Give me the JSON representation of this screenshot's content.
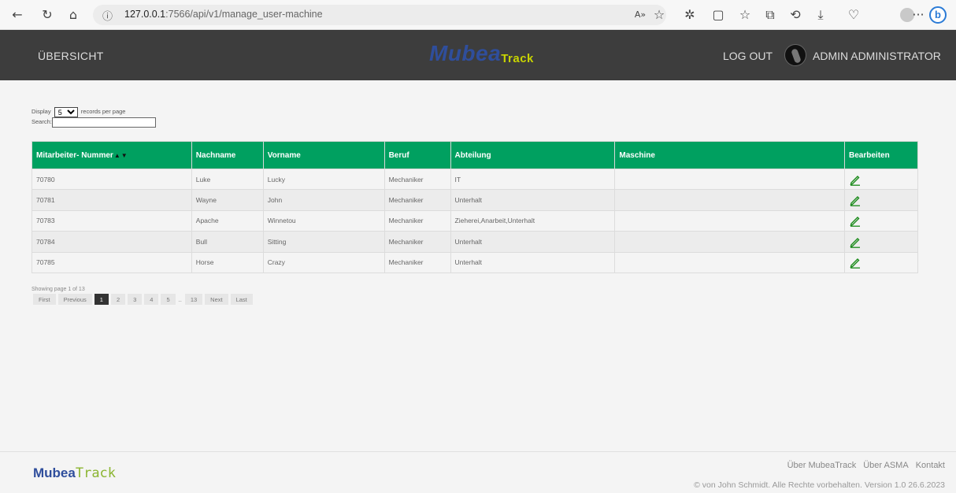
{
  "browser": {
    "url_host": "127.0.0.1",
    "url_path": ":7566/api/v1/manage_user-machine",
    "icons": [
      "back-icon",
      "refresh-icon",
      "home-icon",
      "read-aloud-icon",
      "favorite-icon",
      "extensions-icon",
      "split-screen-icon",
      "favorites-icon",
      "collections-icon",
      "history-icon",
      "downloads-icon",
      "performance-icon",
      "profile-icon",
      "more-icon",
      "bing-icon"
    ],
    "more_label": "···",
    "bing_label": "b"
  },
  "header": {
    "overview": "ÜBERSICHT",
    "logo_main": "Mubea",
    "logo_sub": "Track",
    "logout": "LOG OUT",
    "user": "ADMIN ADMINISTRATOR"
  },
  "controls": {
    "display_label": "Display",
    "display_value": "5",
    "display_suffix": "records per page",
    "search_label": "Search:",
    "search_value": ""
  },
  "table": {
    "columns": [
      "Mitarbeiter- Nummer",
      "Nachname",
      "Vorname",
      "Beruf",
      "Abteilung",
      "Maschine",
      "Bearbeiten"
    ],
    "sort_up": "▲",
    "sort_down": "▼",
    "rows": [
      [
        "70780",
        "Luke",
        "Lucky",
        "Mechaniker",
        "IT",
        ""
      ],
      [
        "70781",
        "Wayne",
        "John",
        "Mechaniker",
        "Unterhalt",
        ""
      ],
      [
        "70783",
        "Apache",
        "Winnetou",
        "Mechaniker",
        "Zieherei,Anarbeit,Unterhalt",
        ""
      ],
      [
        "70784",
        "Bull",
        "Sitting",
        "Mechaniker",
        "Unterhalt",
        ""
      ],
      [
        "70785",
        "Horse",
        "Crazy",
        "Mechaniker",
        "Unterhalt",
        ""
      ]
    ],
    "accent": "#00a060"
  },
  "pagination": {
    "showing": "Showing page 1 of 13",
    "first": "First",
    "previous": "Previous",
    "pages": [
      "1",
      "2",
      "3",
      "4",
      "5"
    ],
    "dots": "..",
    "last_page": "13",
    "next": "Next",
    "last": "Last",
    "current": "1"
  },
  "footer": {
    "logo_main": "Mubea",
    "logo_sub": "Track",
    "links": [
      "Über MubeaTrack",
      "Über ASMA",
      "Kontakt"
    ],
    "copyright": "© von John Schmidt. Alle Rechte vorbehalten.   Version 1.0   26.6.2023"
  }
}
